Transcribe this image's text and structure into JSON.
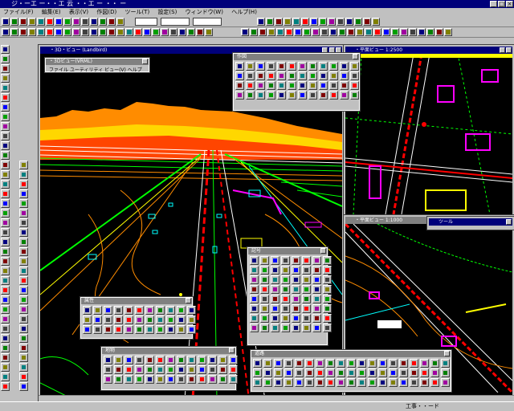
{
  "app": {
    "title": "ジ・ーエ ー・・エ 云 ・・エ ー ・・ ー"
  },
  "menu": {
    "items": [
      "ファイル(F)",
      "編集(E)",
      "表示(V)",
      "作図(D)",
      "ツール(T)",
      "設定(S)",
      "ウィンドウ(W)",
      "ヘルプ(H)"
    ]
  },
  "windows": {
    "main": {
      "title": "・3D・ビュー (Landbird)"
    },
    "plan_top": {
      "title": "・平面ビュー 1:2500"
    },
    "plan_bottom": {
      "title": "・平面ビュー 1:1000"
    },
    "small": {
      "title": "ツール"
    }
  },
  "dialog_3d": {
    "title": "・3Dビュー(VRML)",
    "menu": "ファイル ユーティリティ ビュー(V) ヘルプ"
  },
  "palettes": {
    "p1": {
      "title": "作図"
    },
    "p2": {
      "title": "記号"
    },
    "p3": {
      "title": "属性"
    },
    "p4": {
      "title": "地物"
    },
    "p5": {
      "title": "道路"
    }
  },
  "status": {
    "mode": "工事・・ード"
  },
  "colors": {
    "titlebar": "#00007a",
    "chrome": "#c0c0c0",
    "canvas": "#000000"
  }
}
